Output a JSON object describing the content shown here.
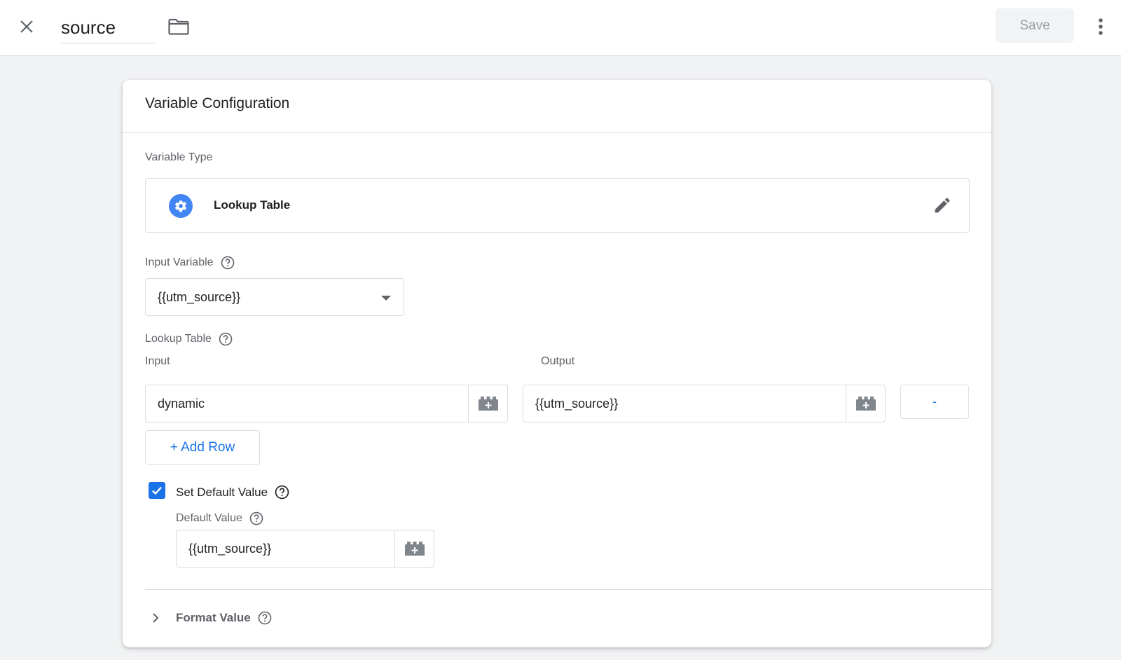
{
  "header": {
    "variable_name": "source",
    "save_label": "Save"
  },
  "card": {
    "title": "Variable Configuration",
    "variable_type": {
      "label": "Variable Type",
      "value": "Lookup Table"
    },
    "input_variable": {
      "label": "Input Variable",
      "value": "{{utm_source}}"
    },
    "lookup_table": {
      "label": "Lookup Table",
      "input_header": "Input",
      "output_header": "Output",
      "rows": [
        {
          "input": "dynamic",
          "output": "{{utm_source}}"
        }
      ],
      "remove_label": "-",
      "add_row_label": "+ Add Row"
    },
    "default_value": {
      "checkbox_label": "Set Default Value",
      "checked": true,
      "label": "Default Value",
      "value": "{{utm_source}}"
    },
    "format_value": {
      "label": "Format Value"
    }
  },
  "colors": {
    "accent": "#1a73e8",
    "type_icon": "#4285f4",
    "background": "#f1f2f3"
  },
  "icons": {
    "close": "close-icon",
    "folder": "folder-icon",
    "more": "more-vert-icon",
    "variable_type": "gear-icon",
    "edit": "pencil-icon",
    "help": "help-icon",
    "variable_picker": "brick-plus-icon",
    "expand": "chevron-right-icon"
  }
}
